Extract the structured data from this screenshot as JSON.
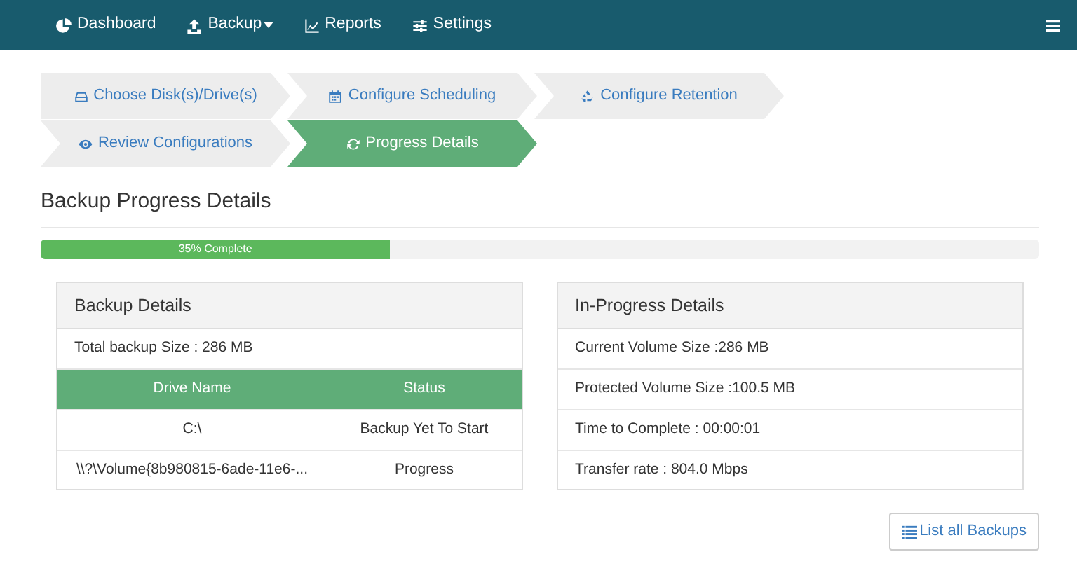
{
  "navbar": {
    "items": [
      {
        "label": "Dashboard",
        "dropdown": false
      },
      {
        "label": "Backup",
        "dropdown": true
      },
      {
        "label": "Reports",
        "dropdown": false
      },
      {
        "label": "Settings",
        "dropdown": false
      }
    ]
  },
  "wizard_steps": [
    {
      "label": "Choose Disk(s)/Drive(s)",
      "selected": false
    },
    {
      "label": "Configure Scheduling",
      "selected": false
    },
    {
      "label": "Configure Retention",
      "selected": false
    },
    {
      "label": "Review Configurations",
      "selected": false
    },
    {
      "label": "Progress Details",
      "selected": true
    }
  ],
  "heading": "Backup Progress Details",
  "progress": {
    "level": 0.35,
    "label": "35% Complete"
  },
  "backup_details": {
    "title": "Backup Details",
    "total": "Total backup Size : 286 MB",
    "columns": [
      "Drive Name",
      "Status"
    ],
    "rows": [
      [
        "C:\\",
        "Backup Yet To Start"
      ],
      [
        "\\\\?\\Volume{8b980815-6ade-11e6-...",
        "Progress"
      ]
    ]
  },
  "in_progress_details": {
    "title": "In-Progress Details",
    "items": [
      "Current Volume Size :286 MB",
      "Protected Volume Size :100.5 MB",
      "Time to Complete : 00:00:01",
      "Transfer rate : 804.0 Mbps"
    ]
  },
  "list_button": "List all Backups"
}
